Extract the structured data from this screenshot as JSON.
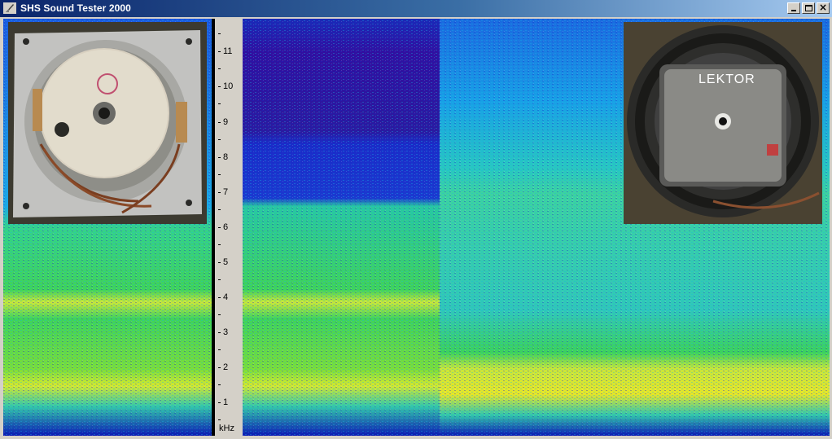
{
  "window": {
    "title": "SHS Sound Tester 2000",
    "controls": {
      "minimize_icon": "minimize-icon",
      "maximize_icon": "maximize-icon",
      "close_icon": "close-icon"
    }
  },
  "axis": {
    "unit": "kHz",
    "ticks": [
      "11",
      "10",
      "9",
      "8",
      "7",
      "6",
      "5",
      "4",
      "3",
      "2",
      "1"
    ]
  },
  "photos": {
    "left": {
      "subject": "rear of loudspeaker with metal frame"
    },
    "right": {
      "brand_label": "LEKTOR",
      "subject": "rear of black loudspeaker with magnet label"
    }
  },
  "colors": {
    "spectrogram_low": "#0a0ab4",
    "spectrogram_mid": "#12b4e6",
    "spectrogram_high": "#3cd24a",
    "spectrogram_peak": "#e6e628",
    "panel": "#d4d0c8",
    "titlebar_start": "#0a246a",
    "titlebar_end": "#a6caf0"
  }
}
